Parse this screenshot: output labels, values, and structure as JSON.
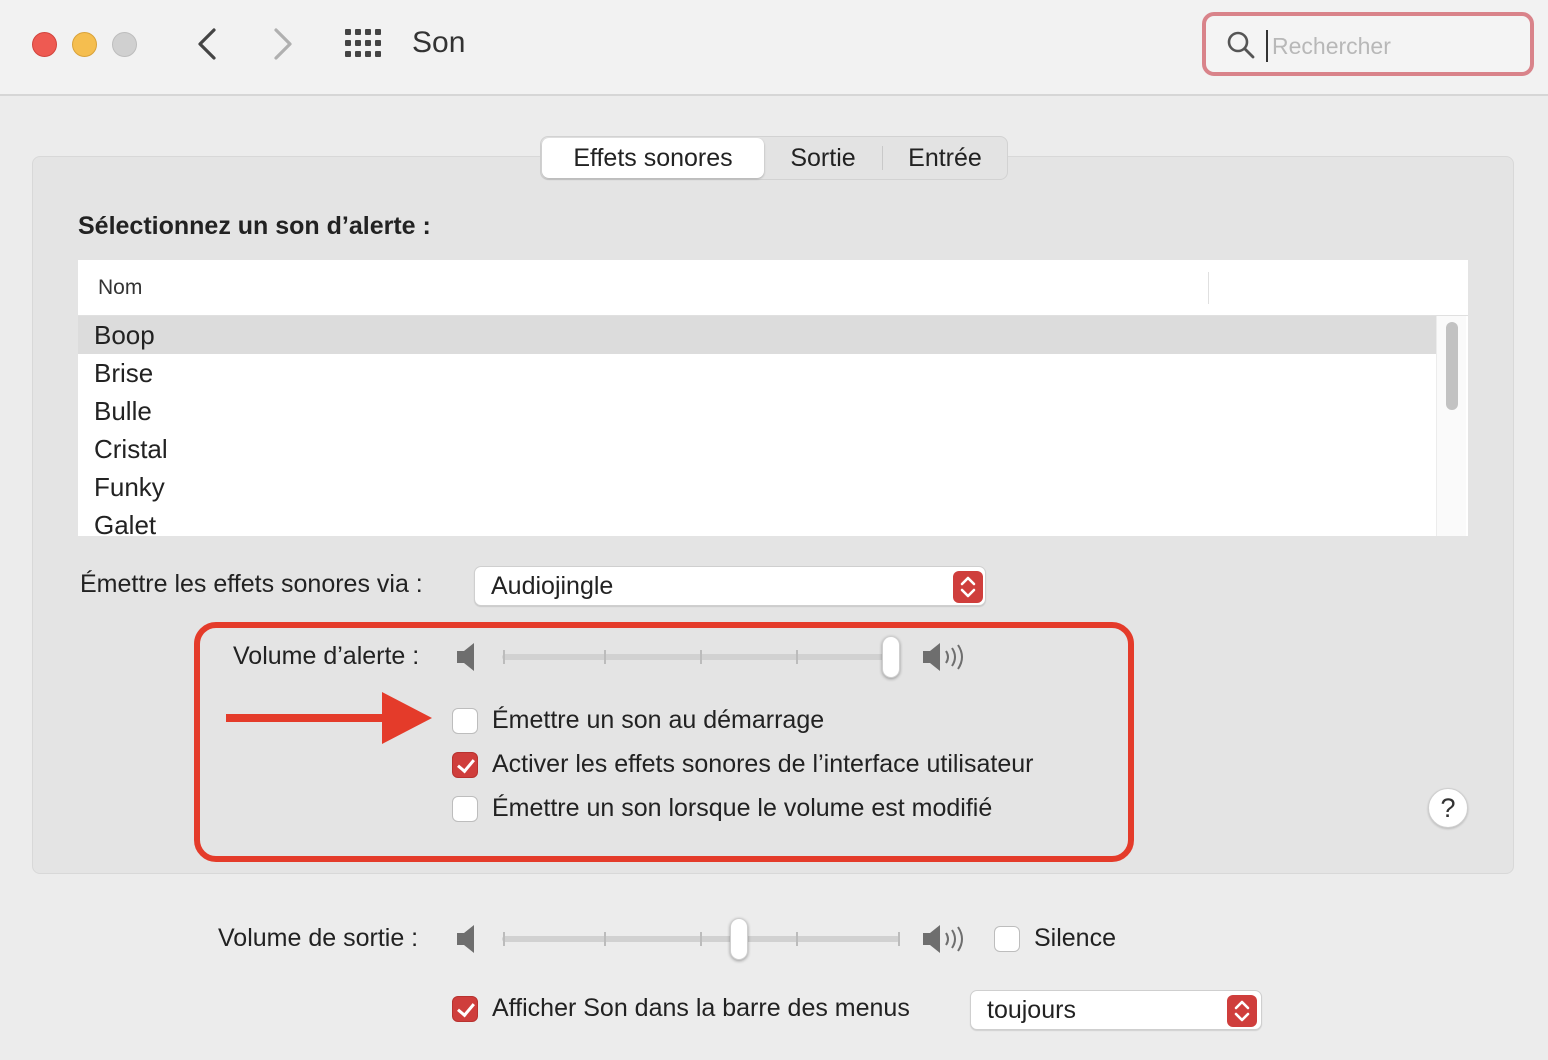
{
  "window": {
    "title": "Son",
    "search_placeholder": "Rechercher"
  },
  "tabs": [
    {
      "label": "Effets sonores",
      "active": true
    },
    {
      "label": "Sortie",
      "active": false
    },
    {
      "label": "Entrée",
      "active": false
    }
  ],
  "alert_sounds": {
    "section_label": "Sélectionnez un son d’alerte :",
    "column_header": "Nom",
    "items": [
      "Boop",
      "Brise",
      "Bulle",
      "Cristal",
      "Funky",
      "Galet"
    ],
    "selected": "Boop"
  },
  "output_device": {
    "label": "Émettre les effets sonores via :",
    "value": "Audiojingle"
  },
  "alert_volume": {
    "label": "Volume d’alerte :",
    "level": 1.0
  },
  "options": [
    {
      "label": "Émettre un son au démarrage",
      "checked": false
    },
    {
      "label": "Activer les effets sonores de l’interface utilisateur",
      "checked": true
    },
    {
      "label": "Émettre un son lorsque le volume est modifié",
      "checked": false
    }
  ],
  "help": {
    "label": "?"
  },
  "output_volume": {
    "label": "Volume de sortie :",
    "level": 0.6,
    "mute_label": "Silence",
    "mute_checked": false
  },
  "menu_bar": {
    "label": "Afficher Son dans la barre des menus",
    "checked": true,
    "value": "toujours"
  },
  "colors": {
    "accent": "#cf3e3c",
    "highlight": "#e43b2a",
    "search_focus": "#d9838a"
  },
  "icons": [
    "close-icon",
    "minimize-icon",
    "zoom-icon",
    "chevron-left-icon",
    "chevron-right-icon",
    "grid-icon",
    "search-icon",
    "speaker-low-icon",
    "speaker-high-icon",
    "up-down-arrows-icon",
    "arrow-icon"
  ]
}
